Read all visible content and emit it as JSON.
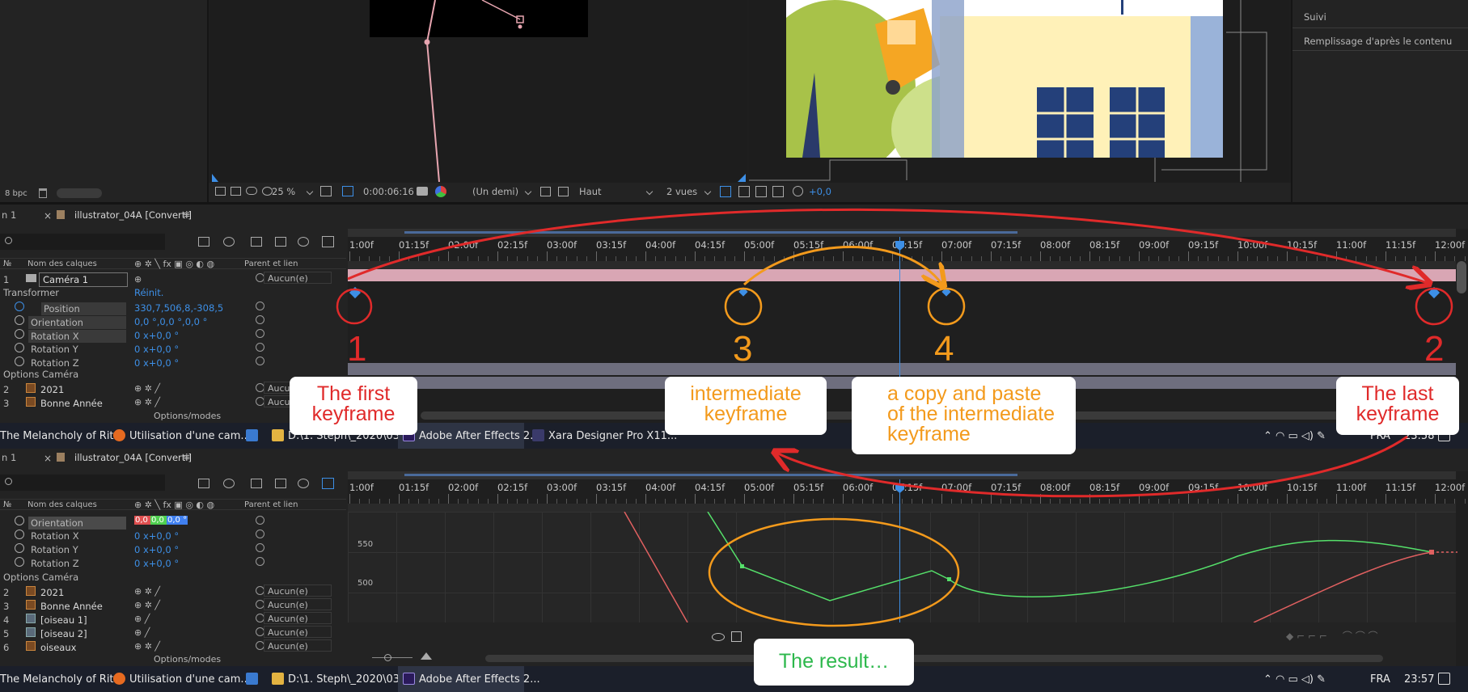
{
  "top": {
    "bpc": "8 bpc",
    "zoom": "25 %",
    "timecode": "0:00:06:16",
    "resolution": "(Un demi)",
    "view": "Haut",
    "views": "2 vues",
    "exposure": "+0,0",
    "right_panel": [
      "Suivi",
      "Remplissage d'après le contenu"
    ]
  },
  "timeline1": {
    "tab_prefix": "n 1",
    "tab": "illustrator_04A [Converti]",
    "col_layer_name": "Nom des calques",
    "col_parent": "Parent et lien",
    "layer1_num": "1",
    "layer1_name": "Caméra 1",
    "layer1_parent": "Aucun(e)",
    "transform": "Transformer",
    "reset": "Réinit.",
    "props": [
      {
        "name": "Position",
        "value": "330,7,506,8,-308,5"
      },
      {
        "name": "Orientation",
        "value": "0,0 °,0,0 °,0,0 °"
      },
      {
        "name": "Rotation X",
        "value": "0 x+0,0 °"
      },
      {
        "name": "Rotation Y",
        "value": "0 x+0,0 °"
      },
      {
        "name": "Rotation Z",
        "value": "0 x+0,0 °"
      }
    ],
    "camera_options": "Options Caméra",
    "layers": [
      {
        "num": "2",
        "name": "2021",
        "parent": "Aucun"
      },
      {
        "num": "3",
        "name": "Bonne Année",
        "parent": "Aucun"
      }
    ],
    "footer": "Options/modes"
  },
  "ruler_labels": [
    "1:00f",
    "01:15f",
    "02:00f",
    "02:15f",
    "03:00f",
    "03:15f",
    "04:00f",
    "04:15f",
    "05:00f",
    "05:15f",
    "06:00f",
    "06:15f",
    "07:00f",
    "07:15f",
    "08:00f",
    "08:15f",
    "09:00f",
    "09:15f",
    "10:00f",
    "10:15f",
    "11:00f",
    "11:15f",
    "12:00f"
  ],
  "taskbar1": {
    "items": [
      "The Melancholy of Rit...",
      "Utilisation d'une cam...",
      "D:\\1. Steph\\_2020\\03 ...",
      "Adobe After Effects 2...",
      "Xara Designer Pro X11..."
    ],
    "lang": "FRA",
    "time": "23:58"
  },
  "timeline2": {
    "tab_prefix": "n 1",
    "tab": "illustrator_04A [Converti]",
    "col_layer_name": "Nom des calques",
    "col_parent": "Parent et lien",
    "orientation_label": "Orientation",
    "orientation_vals": [
      "0,0 °",
      "0,0 °",
      "0,0 °"
    ],
    "props": [
      {
        "name": "Rotation X",
        "value": "0 x+0,0 °"
      },
      {
        "name": "Rotation Y",
        "value": "0 x+0,0 °"
      },
      {
        "name": "Rotation Z",
        "value": "0 x+0,0 °"
      }
    ],
    "camera_options": "Options Caméra",
    "layers": [
      {
        "num": "2",
        "name": "2021",
        "parent": "Aucun(e)"
      },
      {
        "num": "3",
        "name": "Bonne Année",
        "parent": "Aucun(e)"
      },
      {
        "num": "4",
        "name": "[oiseau 1]",
        "parent": "Aucun(e)"
      },
      {
        "num": "5",
        "name": "[oiseau 2]",
        "parent": "Aucun(e)"
      },
      {
        "num": "6",
        "name": "oiseaux",
        "parent": "Aucun(e)"
      }
    ],
    "graph_y": [
      "550",
      "500"
    ],
    "footer": "Options/modes"
  },
  "taskbar2": {
    "items": [
      "The Melancholy of Rit...",
      "Utilisation d'une cam...",
      "D:\\1. Steph\\_2020\\03 ...",
      "Adobe After Effects 2..."
    ],
    "lang": "FRA",
    "time": "23:57"
  },
  "annotations": {
    "n1": "1",
    "n2": "2",
    "n3": "3",
    "n4": "4",
    "first": "The first\nkeyframe",
    "intermediate": "intermediate\nkeyframe",
    "copy": "a copy and paste\nof the intermediate\nkeyframe",
    "last": "The last\nkeyframe",
    "result": "The result…"
  },
  "colors": {
    "red": "#e02a2a",
    "orange": "#f39a1c",
    "green": "#2db84c",
    "keyframe": "#3d8fe6",
    "camera_bar": "#d9a6b4"
  }
}
